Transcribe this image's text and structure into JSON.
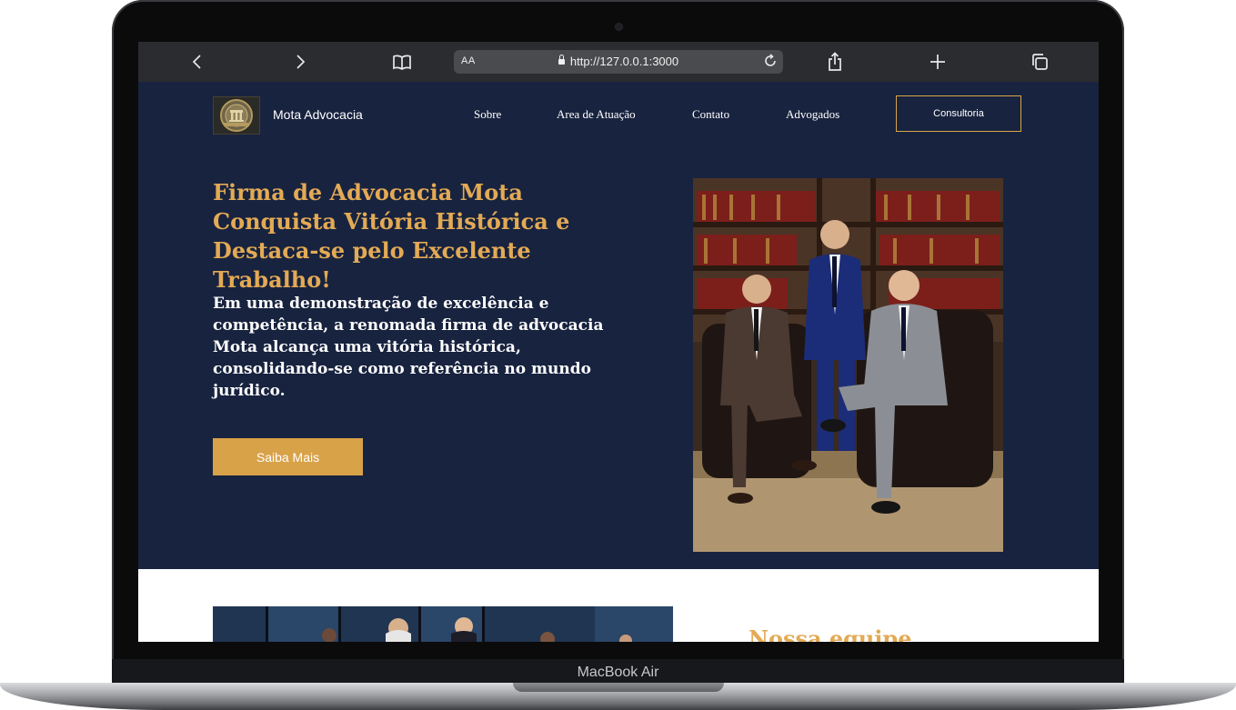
{
  "device": {
    "label": "MacBook Air"
  },
  "browser": {
    "aa_label": "AA",
    "url": "http://127.0.0.1:3000",
    "icons": [
      "back-icon",
      "forward-icon",
      "bookmarks-icon",
      "lock-icon",
      "reload-icon",
      "share-icon",
      "new-tab-icon",
      "tabs-icon"
    ]
  },
  "site": {
    "brand": "Mota Advocacia",
    "nav": [
      "Sobre",
      "Area de Atuação",
      "Contato",
      "Advogados"
    ],
    "cta": "Consultoria"
  },
  "hero": {
    "headline": "Firma de Advocacia Mota Conquista Vitória Histórica e Destaca-se pelo Excelente Trabalho!",
    "subtext": "Em uma demonstração de excelência e competência, a renomada firma de advocacia Mota alcança uma vitória histórica, consolidando-se como referência no mundo jurídico.",
    "button": "Saiba Mais"
  },
  "team": {
    "title": "Nossa equipe"
  },
  "colors": {
    "navy": "#18233f",
    "gold": "#d8a249",
    "gold_text": "#e3aa55"
  }
}
